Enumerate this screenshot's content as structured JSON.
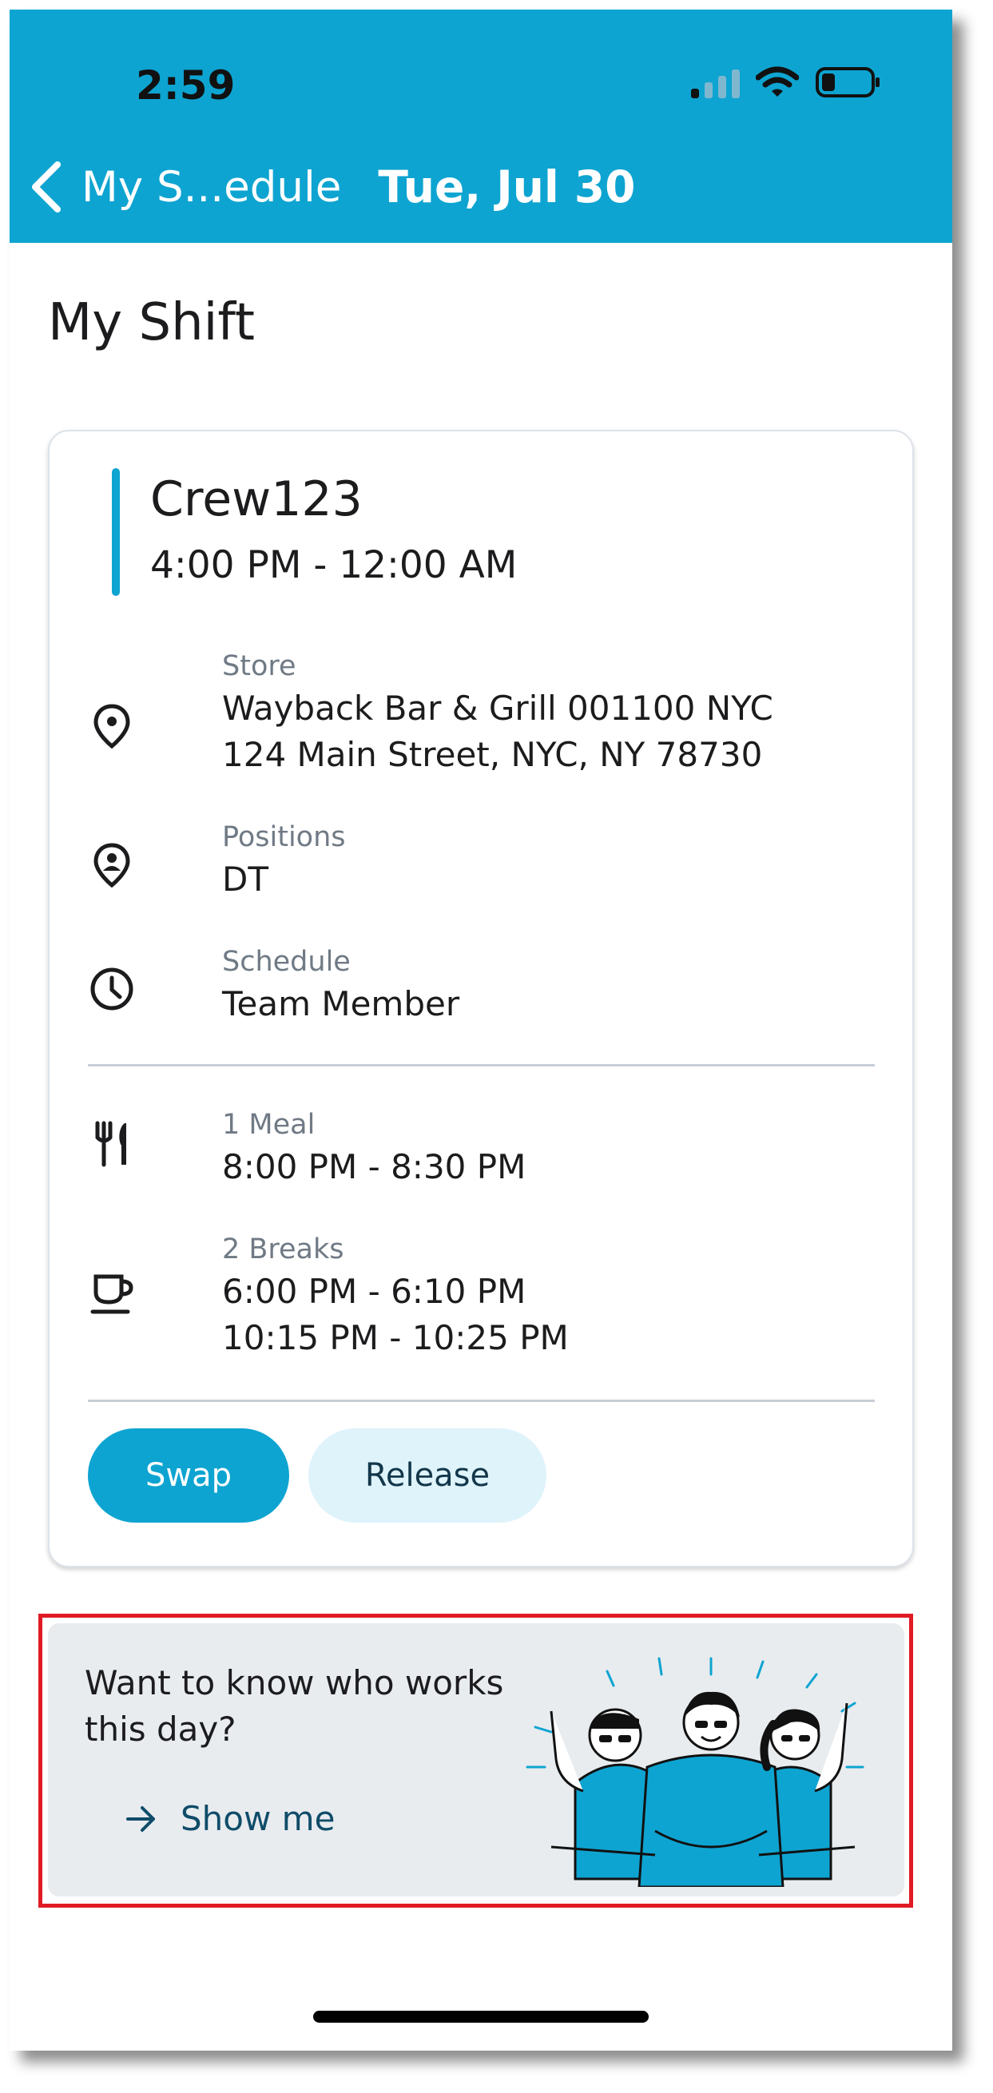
{
  "status_bar": {
    "time": "2:59"
  },
  "header": {
    "back_label": "My S...edule",
    "title": "Tue, Jul 30"
  },
  "page": {
    "title": "My Shift"
  },
  "shift": {
    "crew": "Crew123",
    "time": "4:00 PM - 12:00 AM",
    "store_label": "Store",
    "store_name": "Wayback Bar & Grill 001100 NYC",
    "store_address": "124 Main Street, NYC, NY 78730",
    "positions_label": "Positions",
    "positions_value": "DT",
    "schedule_label": "Schedule",
    "schedule_value": "Team Member",
    "meal_label": "1 Meal",
    "meal_time": "8:00 PM - 8:30 PM",
    "breaks_label": "2 Breaks",
    "break_1": "6:00 PM - 6:10 PM",
    "break_2": "10:15 PM - 10:25 PM"
  },
  "actions": {
    "swap": "Swap",
    "release": "Release"
  },
  "promo": {
    "line1": "Want to know who works",
    "line2": "this day?",
    "cta": "Show me"
  },
  "colors": {
    "accent": "#0ea4d1",
    "release_bg": "#dff3fb",
    "promo_bg": "#e8ecef",
    "highlight_border": "#e01b24"
  },
  "icons": [
    "back-chevron-icon",
    "cellular-signal-icon",
    "wifi-icon",
    "battery-icon",
    "location-pin-icon",
    "person-pin-icon",
    "clock-icon",
    "fork-knife-icon",
    "coffee-cup-icon",
    "arrow-right-icon"
  ]
}
